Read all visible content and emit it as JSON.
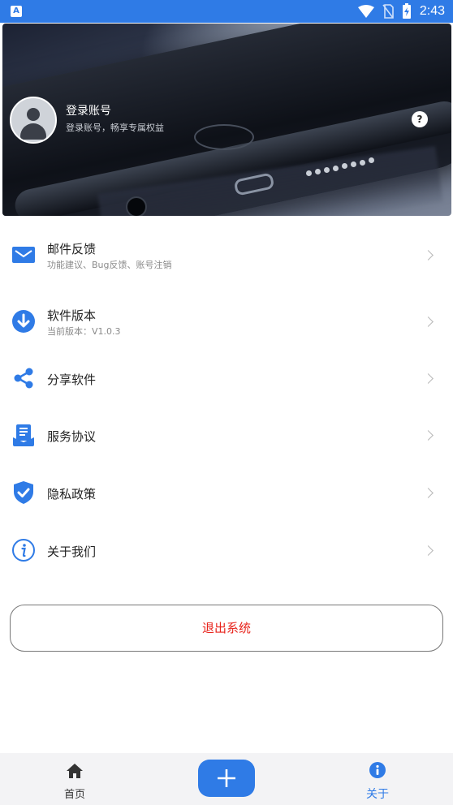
{
  "status_bar": {
    "app_icon_text": "A",
    "time": "2:43"
  },
  "profile": {
    "title": "登录账号",
    "subtitle": "登录账号，畅享专属权益",
    "help": "?"
  },
  "menu": [
    {
      "title": "邮件反馈",
      "subtitle": "功能建议、Bug反馈、账号注销",
      "icon": "mail-icon"
    },
    {
      "title": "软件版本",
      "subtitle": "当前版本：V1.0.3",
      "icon": "download-icon"
    },
    {
      "title": "分享软件",
      "icon": "share-icon"
    },
    {
      "title": "服务协议",
      "icon": "agreement-icon"
    },
    {
      "title": "隐私政策",
      "icon": "shield-check-icon"
    },
    {
      "title": "关于我们",
      "icon": "info-icon"
    }
  ],
  "logout": "退出系统",
  "bottom_nav": {
    "home": "首页",
    "about": "关于"
  },
  "colors": {
    "accent": "#2f7be6",
    "danger": "#e8231b"
  }
}
